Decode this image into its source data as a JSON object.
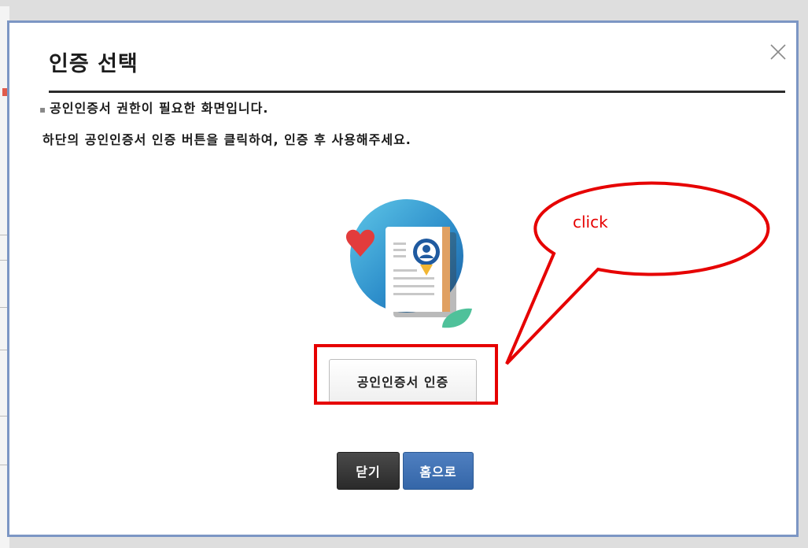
{
  "dialog": {
    "title": "인증 선택",
    "close_icon": "close-icon",
    "message_line1": "공인인증서 권한이 필요한 화면입니다.",
    "message_line2": "하단의 공인인증서 인증 버튼을 클릭하여, 인증 후 사용해주세요.",
    "bullet": "▪",
    "illustration_icon": "certificate-document-icon",
    "cert_button_label": "공인인증서 인증",
    "close_button_label": "닫기",
    "home_button_label": "홈으로"
  },
  "annotation": {
    "callout_text": "click",
    "color": "#e60000"
  },
  "colors": {
    "dialog_border": "#7c96c4",
    "home_button": "#3a6cb0",
    "close_button": "#333333"
  }
}
